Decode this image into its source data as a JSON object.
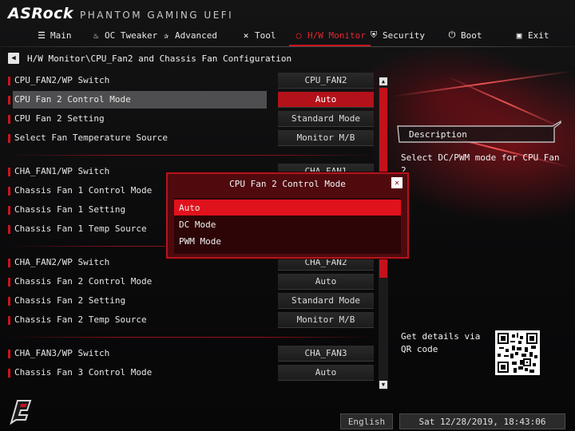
{
  "header": {
    "brand": "ASRock",
    "subtitle": "PHANTOM GAMING UEFI"
  },
  "nav": {
    "tabs": [
      {
        "label": "Main",
        "icon": "list-icon",
        "active": false
      },
      {
        "label": "OC Tweaker",
        "icon": "flame-icon",
        "active": false
      },
      {
        "label": "Advanced",
        "icon": "star-icon",
        "active": false
      },
      {
        "label": "Tool",
        "icon": "wrench-icon",
        "active": false
      },
      {
        "label": "H/W Monitor",
        "icon": "monitor-ring-icon",
        "active": true
      },
      {
        "label": "Security",
        "icon": "shield-icon",
        "active": false
      },
      {
        "label": "Boot",
        "icon": "power-icon",
        "active": false
      },
      {
        "label": "Exit",
        "icon": "exit-door-icon",
        "active": false
      }
    ]
  },
  "breadcrumb": {
    "path": "H/W Monitor\\CPU_Fan2 and Chassis Fan Configuration"
  },
  "settings": [
    {
      "label": "CPU_FAN2/WP Switch",
      "value": "CPU_FAN2"
    },
    {
      "label": "CPU Fan 2 Control Mode",
      "value": "Auto",
      "selected": true
    },
    {
      "label": "CPU Fan 2 Setting",
      "value": "Standard Mode"
    },
    {
      "label": "Select Fan Temperature Source",
      "value": "Monitor M/B"
    },
    {
      "label": "CHA_FAN1/WP Switch",
      "value": "CHA_FAN1"
    },
    {
      "label": "Chassis Fan 1 Control Mode",
      "value": ""
    },
    {
      "label": "Chassis Fan 1 Setting",
      "value": ""
    },
    {
      "label": "Chassis Fan 1 Temp Source",
      "value": ""
    },
    {
      "label": "CHA_FAN2/WP Switch",
      "value": "CHA_FAN2"
    },
    {
      "label": "Chassis Fan 2 Control Mode",
      "value": "Auto"
    },
    {
      "label": "Chassis Fan 2 Setting",
      "value": "Standard Mode"
    },
    {
      "label": "Chassis Fan 2 Temp Source",
      "value": "Monitor M/B"
    },
    {
      "label": "CHA_FAN3/WP Switch",
      "value": "CHA_FAN3"
    },
    {
      "label": "Chassis Fan 3 Control Mode",
      "value": "Auto"
    }
  ],
  "description": {
    "title": "Description",
    "text": "Select DC/PWM mode for CPU Fan 2"
  },
  "qr": {
    "text": "Get details via QR code"
  },
  "popup": {
    "title": "CPU Fan 2 Control Mode",
    "options": [
      "Auto",
      "DC Mode",
      "PWM Mode"
    ],
    "selected_index": 0
  },
  "footer": {
    "language": "English",
    "datetime": "Sat 12/28/2019, 18:43:06"
  },
  "colors": {
    "accent": "#e0121c",
    "selected_value_bg": "#b3121a",
    "popup_bg": "#500a0e",
    "background": "#0b0b0c"
  }
}
